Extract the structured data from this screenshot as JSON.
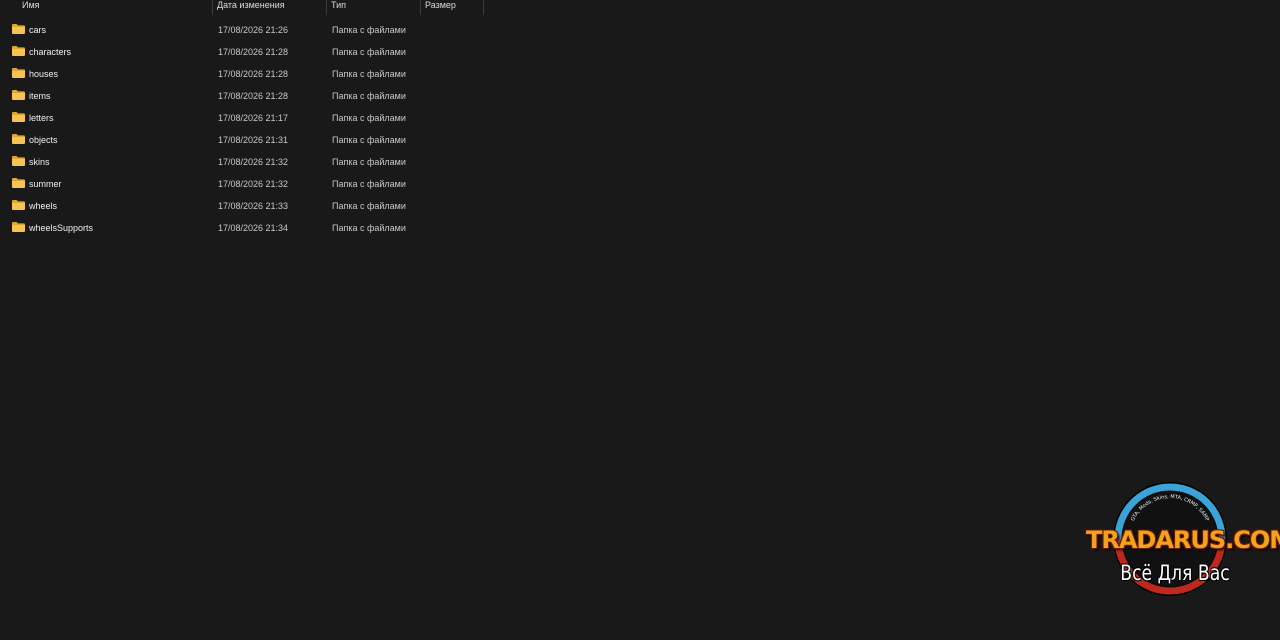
{
  "columns": {
    "name": "Имя",
    "date": "Дата изменения",
    "type": "Тип",
    "size": "Размер"
  },
  "files": [
    {
      "name": "cars",
      "date": "17/08/2026 21:26",
      "type": "Папка с файлами",
      "size": "",
      "icon": "folder-icon"
    },
    {
      "name": "characters",
      "date": "17/08/2026 21:28",
      "type": "Папка с файлами",
      "size": "",
      "icon": "folder-icon"
    },
    {
      "name": "houses",
      "date": "17/08/2026 21:28",
      "type": "Папка с файлами",
      "size": "",
      "icon": "folder-icon"
    },
    {
      "name": "items",
      "date": "17/08/2026 21:28",
      "type": "Папка с файлами",
      "size": "",
      "icon": "folder-icon"
    },
    {
      "name": "letters",
      "date": "17/08/2026 21:17",
      "type": "Папка с файлами",
      "size": "",
      "icon": "folder-icon"
    },
    {
      "name": "objects",
      "date": "17/08/2026 21:31",
      "type": "Папка с файлами",
      "size": "",
      "icon": "folder-icon"
    },
    {
      "name": "skins",
      "date": "17/08/2026 21:32",
      "type": "Папка с файлами",
      "size": "",
      "icon": "folder-icon"
    },
    {
      "name": "summer",
      "date": "17/08/2026 21:32",
      "type": "Папка с файлами",
      "size": "",
      "icon": "folder-icon"
    },
    {
      "name": "wheels",
      "date": "17/08/2026 21:33",
      "type": "Папка с файлами",
      "size": "",
      "icon": "folder-icon"
    },
    {
      "name": "wheelsSupports",
      "date": "17/08/2026 21:34",
      "type": "Папка с файлами",
      "size": "",
      "icon": "folder-icon"
    }
  ],
  "watermark": {
    "brand": "TRADARUS.COM",
    "tagline": "Всё Для Вас",
    "arc_text": "GTA, Mods, Skins, MTA, CRMP, SAMP"
  },
  "colors": {
    "background": "#191919",
    "folder": "#f6c453",
    "folder_dark": "#e0a82e",
    "brand_orange": "#f3a21c",
    "ring_blue": "#3aa3d8",
    "ring_red": "#c0281e"
  }
}
